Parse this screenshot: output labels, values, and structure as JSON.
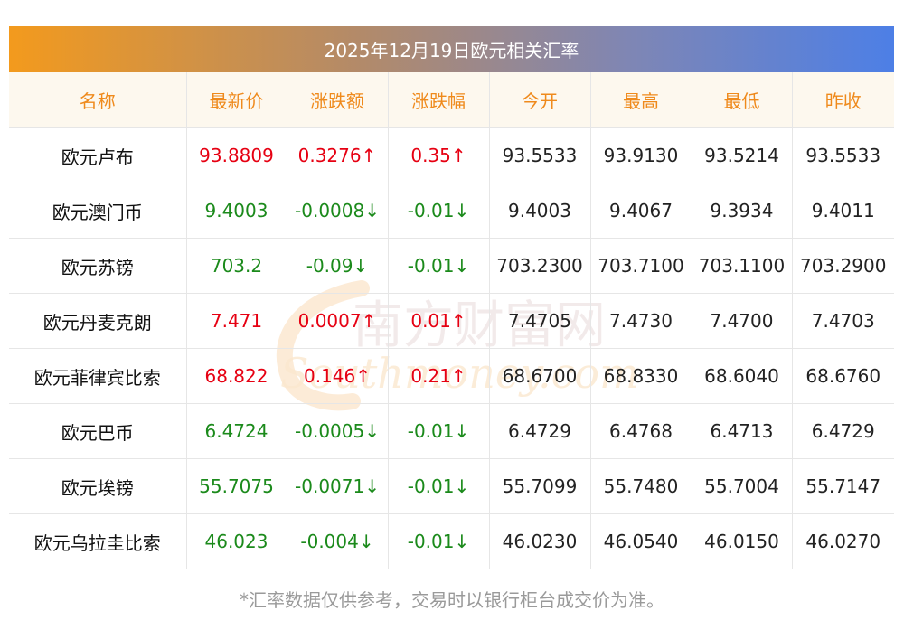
{
  "title": "2025年12月19日欧元相关汇率",
  "headers": [
    "名称",
    "最新价",
    "涨跌额",
    "涨跌幅",
    "今开",
    "最高",
    "最低",
    "昨收"
  ],
  "rows": [
    {
      "name": "欧元卢布",
      "latest": "93.8809",
      "change": "0.3276↑",
      "pct": "0.35↑",
      "dir": "up",
      "open": "93.5533",
      "high": "93.9130",
      "low": "93.5214",
      "prev": "93.5533"
    },
    {
      "name": "欧元澳门币",
      "latest": "9.4003",
      "change": "-0.0008↓",
      "pct": "-0.01↓",
      "dir": "down",
      "open": "9.4003",
      "high": "9.4067",
      "low": "9.3934",
      "prev": "9.4011"
    },
    {
      "name": "欧元苏镑",
      "latest": "703.2",
      "change": "-0.09↓",
      "pct": "-0.01↓",
      "dir": "down",
      "open": "703.2300",
      "high": "703.7100",
      "low": "703.1100",
      "prev": "703.2900"
    },
    {
      "name": "欧元丹麦克朗",
      "latest": "7.471",
      "change": "0.0007↑",
      "pct": "0.01↑",
      "dir": "up",
      "open": "7.4705",
      "high": "7.4730",
      "low": "7.4700",
      "prev": "7.4703"
    },
    {
      "name": "欧元菲律宾比索",
      "latest": "68.822",
      "change": "0.146↑",
      "pct": "0.21↑",
      "dir": "up",
      "open": "68.6700",
      "high": "68.8330",
      "low": "68.6040",
      "prev": "68.6760"
    },
    {
      "name": "欧元巴币",
      "latest": "6.4724",
      "change": "-0.0005↓",
      "pct": "-0.01↓",
      "dir": "down",
      "open": "6.4729",
      "high": "6.4768",
      "low": "6.4713",
      "prev": "6.4729"
    },
    {
      "name": "欧元埃镑",
      "latest": "55.7075",
      "change": "-0.0071↓",
      "pct": "-0.01↓",
      "dir": "down",
      "open": "55.7099",
      "high": "55.7480",
      "low": "55.7004",
      "prev": "55.7147"
    },
    {
      "name": "欧元乌拉圭比索",
      "latest": "46.023",
      "change": "-0.004↓",
      "pct": "-0.01↓",
      "dir": "down",
      "open": "46.0230",
      "high": "46.0540",
      "low": "46.0150",
      "prev": "46.0270"
    }
  ],
  "watermark": {
    "cn": "南方财富网",
    "en": "Southmoney.com"
  },
  "footnote": "*汇率数据仅供参考，交易时以银行柜台成交价为准。",
  "colors": {
    "up": "#e60012",
    "down": "#1b8a1b",
    "header_text": "#ef8a1c"
  }
}
